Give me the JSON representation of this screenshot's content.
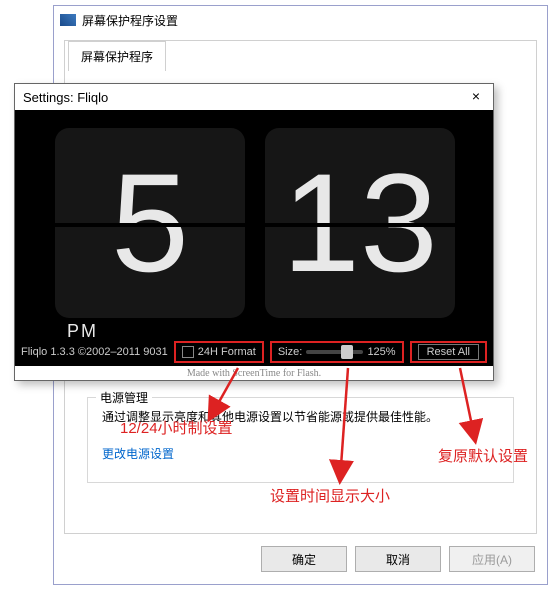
{
  "parent": {
    "title": "屏幕保护程序设置",
    "tab": "屏幕保护程序",
    "power_group_title": "电源管理",
    "power_desc": "通过调整显示亮度和其他电源设置以节省能源或提供最佳性能。",
    "power_link": "更改电源设置",
    "ok": "确定",
    "cancel": "取消",
    "apply": "应用(A)"
  },
  "fliqlo": {
    "title": "Settings: Fliqlo",
    "hour": "5",
    "minute": "13",
    "ampm": "PM",
    "version": "Fliqlo 1.3.3 ©2002–2011 9031",
    "format_label": "24H Format",
    "size_label": "Size:",
    "size_value": "125%",
    "reset": "Reset All",
    "footer": "Made with ScreenTime for Flash."
  },
  "annotations": {
    "format": "12/24小时制设置",
    "size": "设置时间显示大小",
    "reset": "复原默认设置"
  }
}
